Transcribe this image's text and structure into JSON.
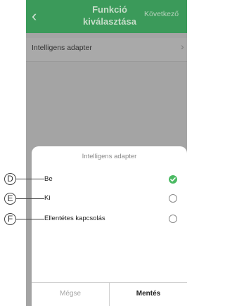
{
  "header": {
    "title": "Funkció kiválasztása",
    "next_label": "Következő",
    "back_icon": "chevron-left-icon",
    "color": "#3b9a5a"
  },
  "list": {
    "item_label": "Intelligens adapter",
    "item_icon": "chevron-right-icon"
  },
  "sheet": {
    "title": "Intelligens adapter",
    "options": [
      {
        "label": "Be",
        "selected": true
      },
      {
        "label": "Ki",
        "selected": false
      },
      {
        "label": "Ellentétes kapcsolás",
        "selected": false
      }
    ],
    "cancel_label": "Mégse",
    "save_label": "Mentés",
    "accent": "#4bba63"
  },
  "callouts": [
    "D",
    "E",
    "F"
  ]
}
